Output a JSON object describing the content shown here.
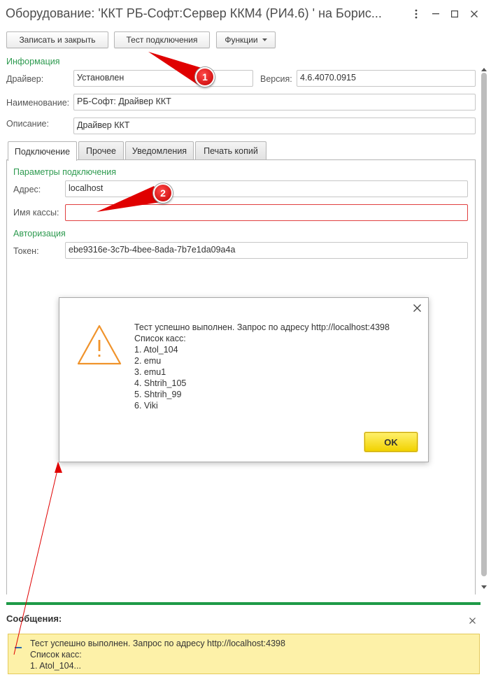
{
  "window": {
    "title": "Оборудование: 'ККТ РБ-Софт:Сервер ККМ4 (РИ4.6) ' на Борис..."
  },
  "toolbar": {
    "save_close": "Записать и закрыть",
    "test_connection": "Тест подключения",
    "functions": "Функции"
  },
  "info": {
    "group_label": "Информация",
    "driver_label": "Драйвер:",
    "driver_value": "Установлен",
    "version_label": "Версия:",
    "version_value": "4.6.4070.0915",
    "name_label": "Наименование:",
    "name_value": "РБ-Софт: Драйвер ККТ",
    "desc_label": "Описание:",
    "desc_value": "Драйвер ККТ"
  },
  "tabs": [
    "Подключение",
    "Прочее",
    "Уведомления",
    "Печать копий"
  ],
  "connection": {
    "group_label": "Параметры подключения",
    "address_label": "Адрес:",
    "address_value": "localhost",
    "cashier_label": "Имя кассы:",
    "cashier_value": "",
    "auth_label": "Авторизация",
    "token_label": "Токен:",
    "token_value": "ebe9316e-3c7b-4bee-8ada-7b7e1da09a4a"
  },
  "dialog": {
    "line1": "Тест успешно выполнен. Запрос по адресу http://localhost:4398",
    "line2": "Список касс:",
    "items": [
      "1. Atol_104",
      "2. emu",
      "3. emu1",
      "4. Shtrih_105",
      "5. Shtrih_99",
      "6. Viki"
    ],
    "ok_label": "OK"
  },
  "messages": {
    "title": "Сообщения:",
    "line1": "Тест успешно выполнен. Запрос по адресу http://localhost:4398",
    "line2": "Список касс:",
    "line3": "1. Atol_104..."
  },
  "annotations": {
    "badge1": "1",
    "badge2": "2"
  },
  "colors": {
    "accent_green": "#2d9a4f",
    "ok_yellow": "#f1d200",
    "message_bg": "#fdf1a8",
    "annotation_red": "#e00000",
    "error_border": "#e04040",
    "warning_orange": "#f0932b"
  }
}
